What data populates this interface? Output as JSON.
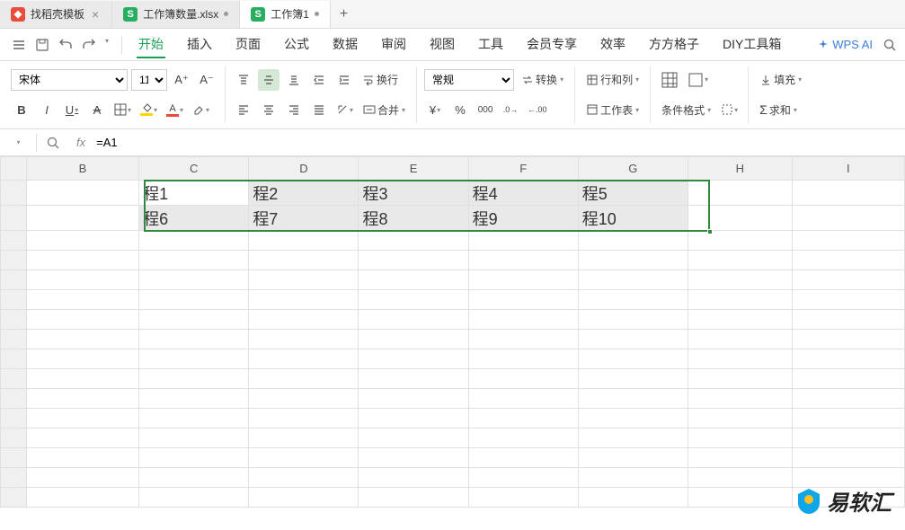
{
  "tabs": [
    {
      "icon": "red",
      "label": "找稻壳模板",
      "closable": true
    },
    {
      "icon": "green",
      "iconText": "S",
      "label": "工作簿数量.xlsx",
      "modified": true
    },
    {
      "icon": "green",
      "iconText": "S",
      "label": "工作簿1",
      "modified": true,
      "active": true
    }
  ],
  "newTab": "+",
  "menu": {
    "items": [
      "开始",
      "插入",
      "页面",
      "公式",
      "数据",
      "审阅",
      "视图",
      "工具",
      "会员专享",
      "效率",
      "方方格子",
      "DIY工具箱"
    ],
    "activeIndex": 0,
    "wpsAi": "WPS AI"
  },
  "ribbon": {
    "fontName": "宋体",
    "fontSize": "11",
    "bold": "B",
    "italic": "I",
    "underline": "U",
    "strike": "A",
    "wrap": "换行",
    "merge": "合并",
    "numberFormat": "常规",
    "convert": "转换",
    "rowcol": "行和列",
    "worksheet": "工作表",
    "condFormat": "条件格式",
    "fill": "填充",
    "sum": "求和",
    "currency": "¥",
    "percent": "%",
    "comma": "000",
    "decDown": "←0",
    "decInc": ".00"
  },
  "formulaBar": {
    "fx": "fx",
    "value": "=A1"
  },
  "columns": [
    "B",
    "C",
    "D",
    "E",
    "F",
    "G",
    "H",
    "I"
  ],
  "cells": {
    "row1": [
      "程1",
      "程2",
      "程3",
      "程4",
      "程5"
    ],
    "row2": [
      "程6",
      "程7",
      "程8",
      "程9",
      "程10"
    ]
  },
  "watermark": "易软汇"
}
